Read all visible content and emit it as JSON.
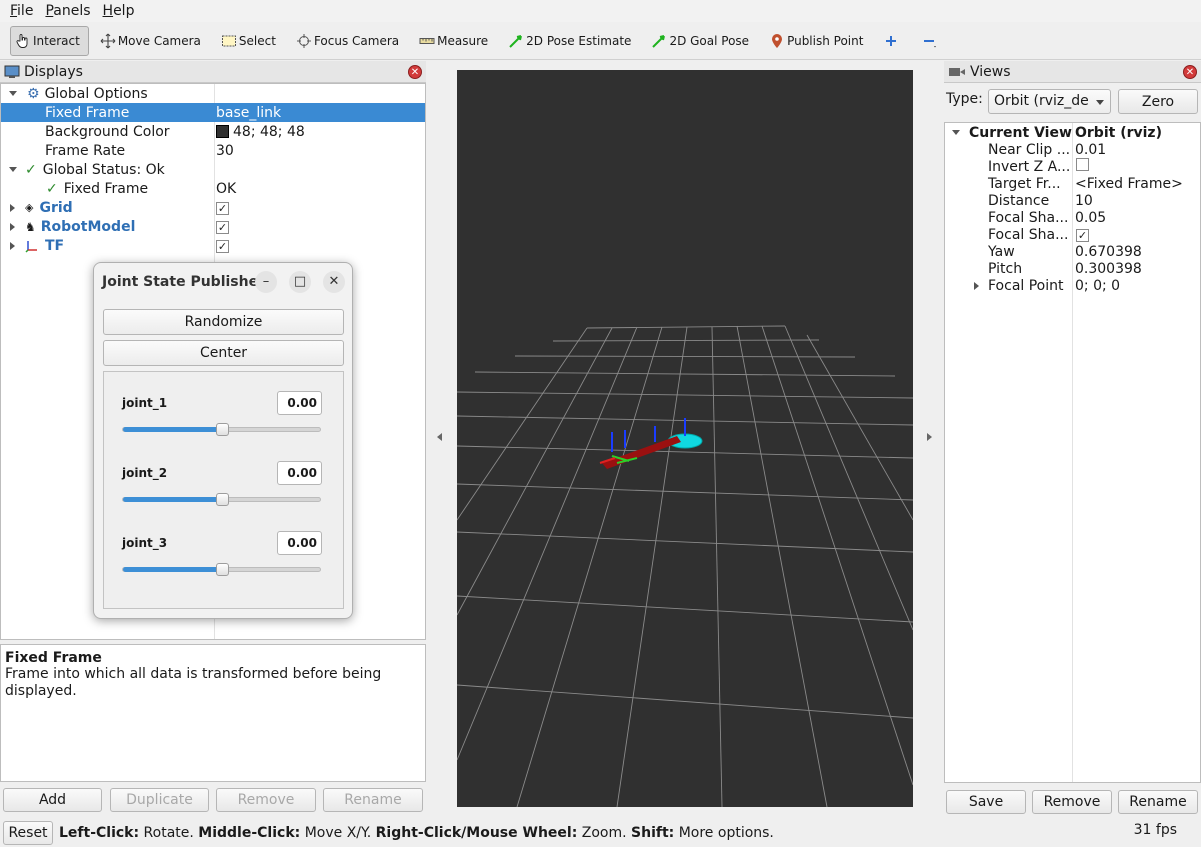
{
  "menu": [
    {
      "first": "F",
      "rest": "ile"
    },
    {
      "first": "P",
      "rest": "anels"
    },
    {
      "first": "H",
      "rest": "elp"
    }
  ],
  "toolbar": {
    "interact": "Interact",
    "move_camera": "Move Camera",
    "select": "Select",
    "focus_camera": "Focus Camera",
    "measure": "Measure",
    "pose_estimate": "2D Pose Estimate",
    "goal_pose": "2D Goal Pose",
    "publish_point": "Publish Point",
    "add_icon": "plus-icon",
    "remove_icon": "minus-icon"
  },
  "displays": {
    "title": "Displays",
    "global_options": "Global Options",
    "fixed_frame_label": "Fixed Frame",
    "fixed_frame_value": "base_link",
    "bg_color_label": "Background Color",
    "bg_color_value": "48; 48; 48",
    "bg_color_swatch": "#303030",
    "frame_rate_label": "Frame Rate",
    "frame_rate_value": "30",
    "global_status": "Global Status: Ok",
    "status_fixed_frame": "Fixed Frame",
    "status_ok": "OK",
    "grid": "Grid",
    "robot_model": "RobotModel",
    "tf": "TF"
  },
  "description": {
    "title": "Fixed Frame",
    "text": "Frame into which all data is transformed before being displayed."
  },
  "display_buttons": {
    "add": "Add",
    "duplicate": "Duplicate",
    "remove": "Remove",
    "rename": "Rename"
  },
  "joint_dialog": {
    "title": "Joint State Publisher",
    "randomize": "Randomize",
    "center": "Center",
    "joints": [
      {
        "name": "joint_1",
        "value": "0.00",
        "position": 0.5
      },
      {
        "name": "joint_2",
        "value": "0.00",
        "position": 0.5
      },
      {
        "name": "joint_3",
        "value": "0.00",
        "position": 0.5
      }
    ]
  },
  "views": {
    "title": "Views",
    "type_label": "Type:",
    "type_value": "Orbit (rviz_def",
    "zero": "Zero",
    "current_view": "Current View",
    "current_view_value": "Orbit (rviz)",
    "props": [
      {
        "label": "Near Clip ...",
        "value": "0.01"
      },
      {
        "label": "Invert Z A...",
        "value": "",
        "checkbox": false
      },
      {
        "label": "Target Fr...",
        "value": "<Fixed Frame>"
      },
      {
        "label": "Distance",
        "value": "10"
      },
      {
        "label": "Focal Sha...",
        "value": "0.05"
      },
      {
        "label": "Focal Sha...",
        "value": "",
        "checkbox": true
      },
      {
        "label": "Yaw",
        "value": "0.670398"
      },
      {
        "label": "Pitch",
        "value": "0.300398"
      },
      {
        "label": "Focal Point",
        "value": "0; 0; 0"
      }
    ],
    "save": "Save",
    "remove": "Remove",
    "rename": "Rename"
  },
  "statusbar": {
    "reset": "Reset",
    "left_click": "Left-Click:",
    "left_click_desc": " Rotate. ",
    "middle_click": "Middle-Click:",
    "middle_click_desc": " Move X/Y. ",
    "right_click": "Right-Click/Mouse Wheel:",
    "right_click_desc": " Zoom. ",
    "shift": "Shift:",
    "shift_desc": " More options.",
    "fps": "31 fps"
  }
}
